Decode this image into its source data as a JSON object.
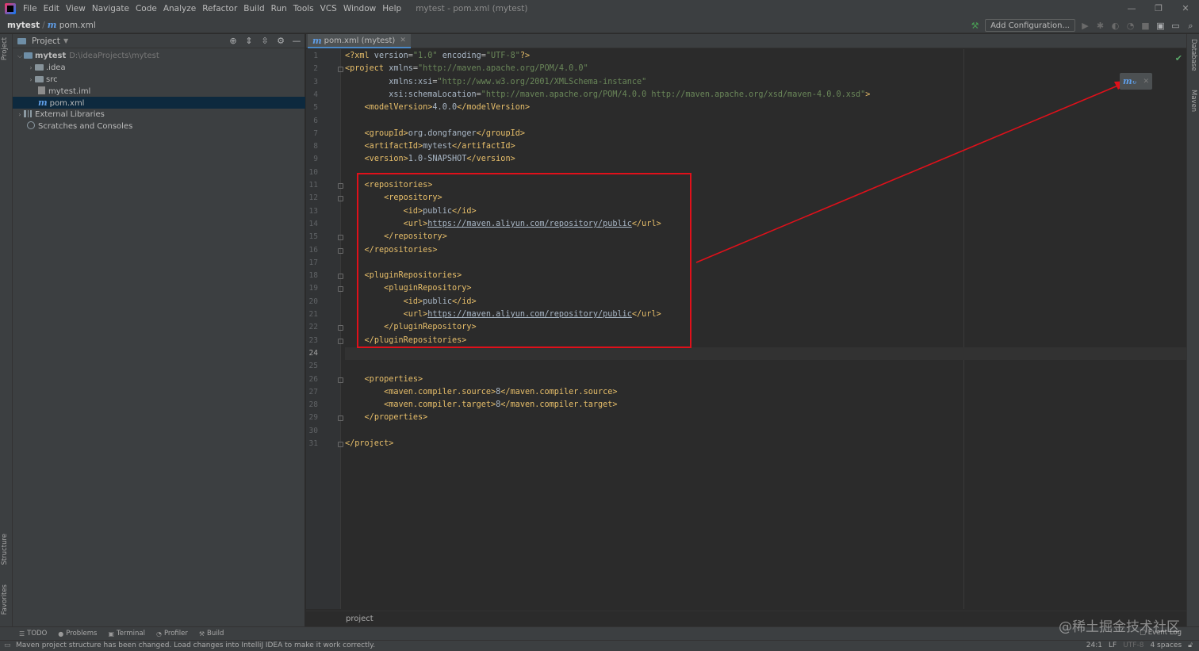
{
  "app": {
    "title": "mytest - pom.xml (mytest)",
    "menu": [
      "File",
      "Edit",
      "View",
      "Navigate",
      "Code",
      "Analyze",
      "Refactor",
      "Build",
      "Run",
      "Tools",
      "VCS",
      "Window",
      "Help"
    ],
    "window_controls": [
      "—",
      "❐",
      "✕"
    ]
  },
  "navbar": {
    "project": "mytest",
    "file": "pom.xml",
    "add_configuration": "Add Configuration..."
  },
  "project_panel": {
    "title": "Project",
    "tree": [
      {
        "label": "mytest",
        "path": "D:\\ideaProjects\\mytest"
      },
      {
        "label": ".idea"
      },
      {
        "label": "src"
      },
      {
        "label": "mytest.iml"
      },
      {
        "label": "pom.xml"
      },
      {
        "label": "External Libraries"
      },
      {
        "label": "Scratches and Consoles"
      }
    ]
  },
  "left_stripe": {
    "project": "Project",
    "structure": "Structure",
    "favorites": "Favorites"
  },
  "right_stripe": {
    "database": "Database",
    "maven": "Maven"
  },
  "editor": {
    "tab_label": "pom.xml (mytest)",
    "current_line": 24,
    "lines": [
      "<?xml version=\"1.0\" encoding=\"UTF-8\"?>",
      "<project xmlns=\"http://maven.apache.org/POM/4.0.0\"",
      "         xmlns:xsi=\"http://www.w3.org/2001/XMLSchema-instance\"",
      "         xsi:schemaLocation=\"http://maven.apache.org/POM/4.0.0 http://maven.apache.org/xsd/maven-4.0.0.xsd\">",
      "    <modelVersion>4.0.0</modelVersion>",
      "",
      "    <groupId>org.dongfanger</groupId>",
      "    <artifactId>mytest</artifactId>",
      "    <version>1.0-SNAPSHOT</version>",
      "",
      "    <repositories>",
      "        <repository>",
      "            <id>public</id>",
      "            <url>https://maven.aliyun.com/repository/public</url>",
      "        </repository>",
      "    </repositories>",
      "",
      "    <pluginRepositories>",
      "        <pluginRepository>",
      "            <id>public</id>",
      "            <url>https://maven.aliyun.com/repository/public</url>",
      "        </pluginRepository>",
      "    </pluginRepositories>",
      "",
      "",
      "    <properties>",
      "        <maven.compiler.source>8</maven.compiler.source>",
      "        <maven.compiler.target>8</maven.compiler.target>",
      "    </properties>",
      "",
      "</project>"
    ],
    "breadcrumb": "project"
  },
  "bottom_tabs": [
    "TODO",
    "Problems",
    "Terminal",
    "Profiler",
    "Build"
  ],
  "event_log": "Event Log",
  "status": {
    "message": "Maven project structure has been changed. Load changes into IntelliJ IDEA to make it work correctly.",
    "position": "24:1",
    "line_sep": "LF",
    "encoding": "UTF-8",
    "indent": "4 spaces"
  },
  "watermark": "@稀土掘金技术社区",
  "colors": {
    "annotation": "#e0101a",
    "selection": "#0d293e",
    "accent": "#4a88c7"
  }
}
